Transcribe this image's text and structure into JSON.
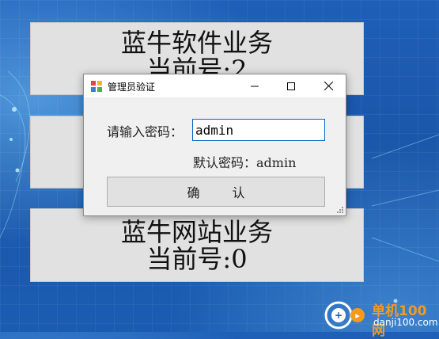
{
  "panels": [
    {
      "title": "蓝牛软件业务",
      "queue": "当前号:2"
    },
    {
      "title": "",
      "queue": ""
    },
    {
      "title": "蓝牛网站业务",
      "queue": "当前号:0"
    }
  ],
  "dialog": {
    "title": "管理员验证",
    "prompt_label": "请输入密码：",
    "password_value": "admin",
    "default_hint": "默认密码：admin",
    "confirm_label": "确 认"
  },
  "watermark": {
    "name": "单机100网",
    "url": "danji100.com"
  },
  "colors": {
    "accent_blue": "#0a63c9",
    "panel_gray": "#e1e1e1",
    "watermark_orange": "#f39a1f"
  }
}
